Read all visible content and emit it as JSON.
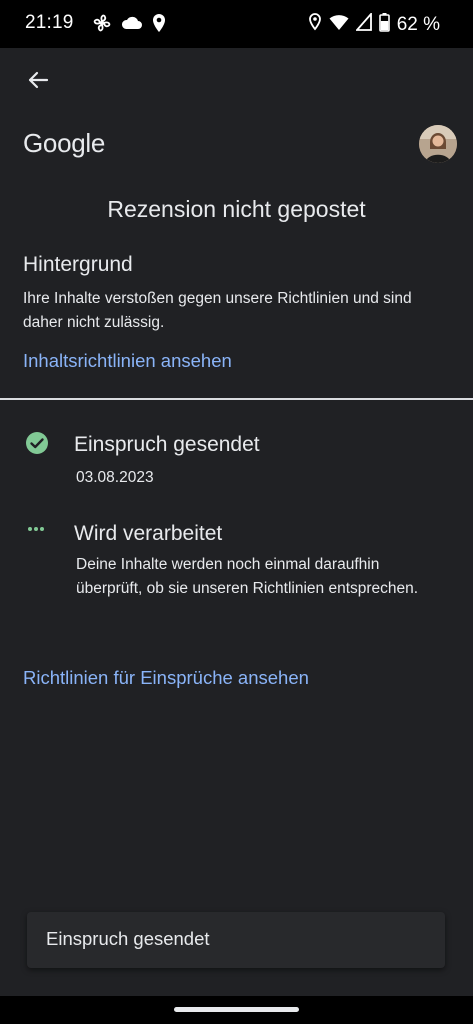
{
  "status_bar": {
    "time": "21:19",
    "battery_percent": "62 %",
    "left_icons": [
      "fan-icon",
      "cloud-icon",
      "location-pin-icon"
    ],
    "right_icons": [
      "location-outline-icon",
      "wifi-icon",
      "cellular-signal-icon",
      "battery-icon"
    ]
  },
  "header": {
    "back_icon": "arrow-back-icon",
    "logo_text": "Google",
    "avatar": "account-avatar"
  },
  "page": {
    "title": "Rezension nicht gepostet"
  },
  "background_section": {
    "heading": "Hintergrund",
    "body": "Ihre Inhalte verstoßen gegen unsere Richtlinien und sind daher nicht zulässig.",
    "link": "Inhaltsrichtlinien ansehen"
  },
  "steps": [
    {
      "icon": "check-circle-icon",
      "title": "Einspruch gesendet",
      "subtitle": "03.08.2023",
      "status": "done"
    },
    {
      "icon": "more-horiz-icon",
      "title": "Wird verarbeitet",
      "subtitle": "Deine Inhalte werden noch einmal daraufhin überprüft, ob sie unseren Richtlinien entsprechen.",
      "status": "in-progress"
    }
  ],
  "appeals_link": "Richtlinien für Einsprüche ansehen",
  "snackbar": {
    "text": "Einspruch gesendet"
  },
  "colors": {
    "background": "#202124",
    "link": "#8ab4f8",
    "success": "#81c995",
    "text": "#e8eaed"
  }
}
